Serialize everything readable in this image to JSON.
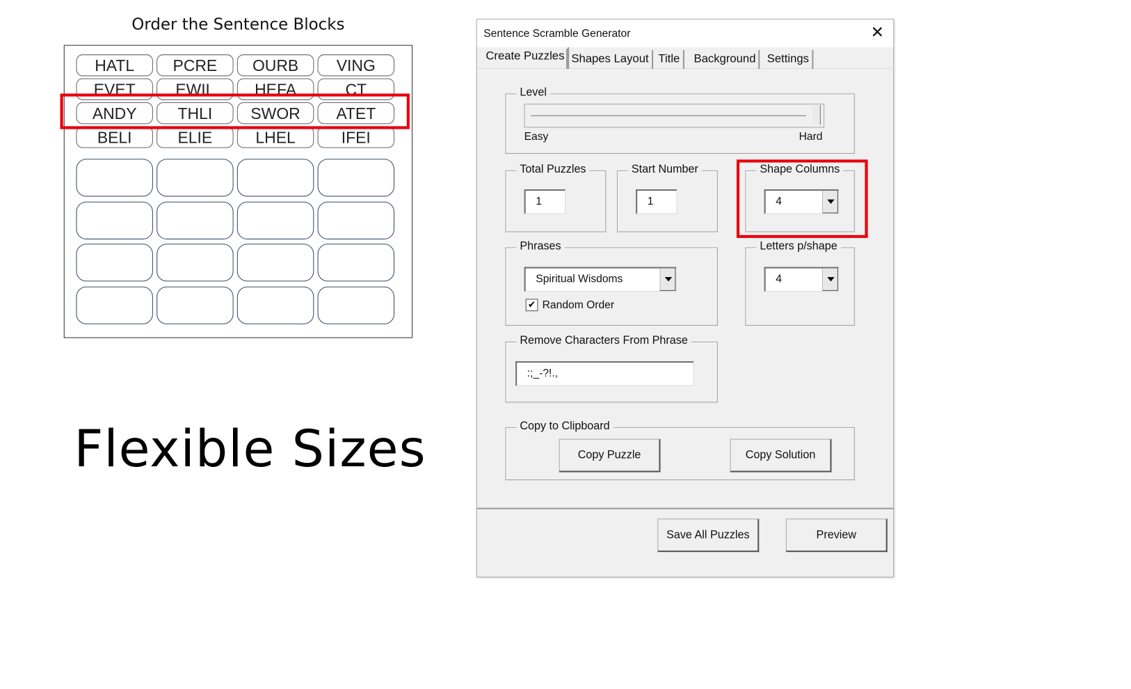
{
  "puzzle": {
    "title": "Order the Sentence Blocks",
    "rows": [
      [
        "HATL",
        "PCRE",
        "OURB",
        "VING"
      ],
      [
        "EVET",
        "EWIL",
        "HEFA",
        "CT"
      ],
      [
        "ANDY",
        "THLI",
        "SWOR",
        "ATET"
      ],
      [
        "BELI",
        "ELIE",
        "LHEL",
        "IFEI"
      ]
    ],
    "empty_rows": 4,
    "columns": 4
  },
  "caption": "Flexible Sizes",
  "highlight_color": "#e8000b",
  "dialog": {
    "title": "Sentence Scramble Generator",
    "close_icon": "close-icon",
    "tabs": [
      {
        "label": "Create Puzzles",
        "selected": true
      },
      {
        "label": "Shapes Layout",
        "selected": false
      },
      {
        "label": "Title",
        "selected": false
      },
      {
        "label": "Background",
        "selected": false
      },
      {
        "label": "Settings",
        "selected": false
      }
    ],
    "level": {
      "label": "Level",
      "min_label": "Easy",
      "max_label": "Hard",
      "value_fraction": 1.0
    },
    "total_puzzles": {
      "label": "Total Puzzles",
      "value": "1"
    },
    "start_number": {
      "label": "Start Number",
      "value": "1"
    },
    "shape_columns": {
      "label": "Shape Columns",
      "value": "4"
    },
    "phrases": {
      "label": "Phrases",
      "value": "Spiritual Wisdoms",
      "random_order_label": "Random Order",
      "random_order": true
    },
    "letters_per_shape": {
      "label": "Letters p/shape",
      "value": "4"
    },
    "remove_chars": {
      "label": "Remove Characters From Phrase",
      "value": ":;_-?!.,"
    },
    "clipboard": {
      "label": "Copy to Clipboard",
      "copy_puzzle": "Copy Puzzle",
      "copy_solution": "Copy Solution"
    },
    "save_all": "Save All Puzzles",
    "preview": "Preview"
  }
}
